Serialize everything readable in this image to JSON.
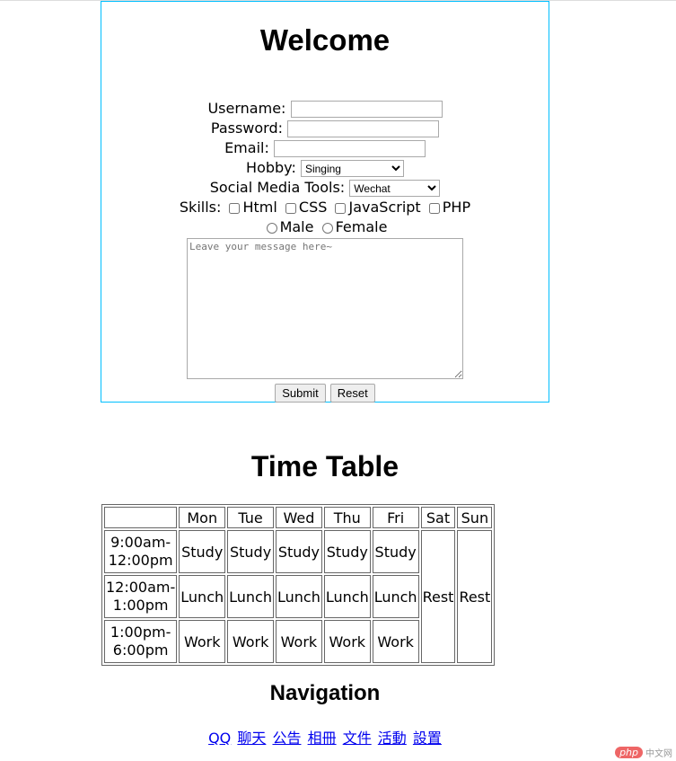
{
  "form": {
    "title": "Welcome",
    "username_label": "Username:",
    "username_value": "",
    "password_label": "Password:",
    "password_value": "",
    "email_label": "Email:",
    "email_value": "",
    "hobby_label": "Hobby:",
    "hobby_selected": "Singing",
    "social_label": "Social Media Tools:",
    "social_selected": "Wechat",
    "skills_label": "Skills:",
    "skills": [
      "Html",
      "CSS",
      "JavaScript",
      "PHP"
    ],
    "genders": [
      "Male",
      "Female"
    ],
    "message_placeholder": "Leave your message here~",
    "submit_label": "Submit",
    "reset_label": "Reset",
    "border_color": "#00bfff"
  },
  "timetable": {
    "title": "Time Table",
    "days": [
      "Mon",
      "Tue",
      "Wed",
      "Thu",
      "Fri",
      "Sat",
      "Sun"
    ],
    "rows": [
      {
        "time_a": "9:00am-",
        "time_b": "12:00pm",
        "activity": "Study"
      },
      {
        "time_a": "12:00am-",
        "time_b": "1:00pm",
        "activity": "Lunch"
      },
      {
        "time_a": "1:00pm-",
        "time_b": "6:00pm",
        "activity": "Work"
      }
    ],
    "weekend": "Rest"
  },
  "navigation": {
    "title": "Navigation",
    "links": [
      "QQ",
      "聊天",
      "公告",
      "相冊",
      "文件",
      "活動",
      "設置"
    ],
    "link_color": "#0000ee"
  },
  "watermark": {
    "logo": "php",
    "text": "中文网"
  }
}
